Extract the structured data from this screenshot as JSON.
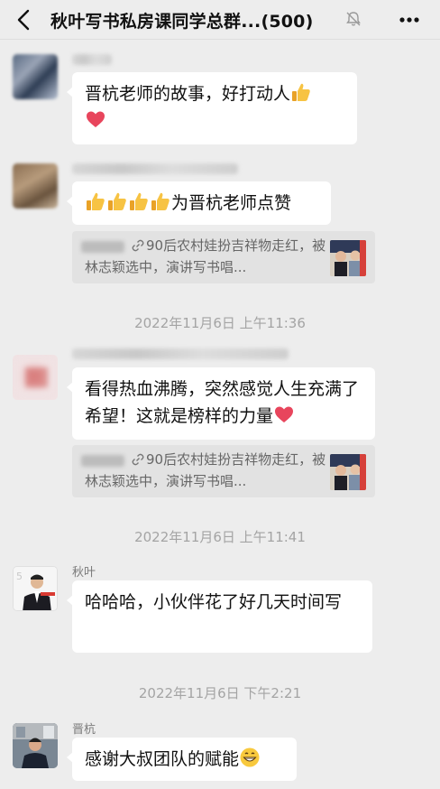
{
  "header": {
    "title": "秋叶写书私房课同学总群...(500)",
    "back_icon": "chevron-left-icon",
    "mute_icon": "bell-mute-icon",
    "more_icon": "more-icon"
  },
  "messages": [
    {
      "text": "晋杭老师的故事，好打动人",
      "emoji": [
        "thumbs-up",
        "heart"
      ]
    },
    {
      "text": "为晋杭老师点赞",
      "emoji": [
        "thumbs-up",
        "thumbs-up",
        "thumbs-up",
        "thumbs-up"
      ],
      "quote": "90后农村娃扮吉祥物走红，被林志颖选中，演讲写书唱..."
    },
    {
      "text": "看得热血沸腾，突然感觉人生充满了希望！这就是榜样的力量",
      "emoji": [
        "heart"
      ],
      "quote": "90后农村娃扮吉祥物走红，被林志颖选中，演讲写书唱..."
    },
    {
      "name": "秋叶",
      "text": "哈哈哈，小伙伴花了好几天时间写"
    },
    {
      "name": "晋杭",
      "text": "感谢大叔团队的赋能",
      "emoji": [
        "grin"
      ]
    }
  ],
  "timestamps": [
    "2022年11月6日 上午11:36",
    "2022年11月6日 上午11:41",
    "2022年11月6日 下午2:21"
  ],
  "colors": {
    "background": "#ededed",
    "bubble": "#ffffff",
    "quote": "#e2e2e2",
    "timestamp": "#a4a4a4"
  }
}
